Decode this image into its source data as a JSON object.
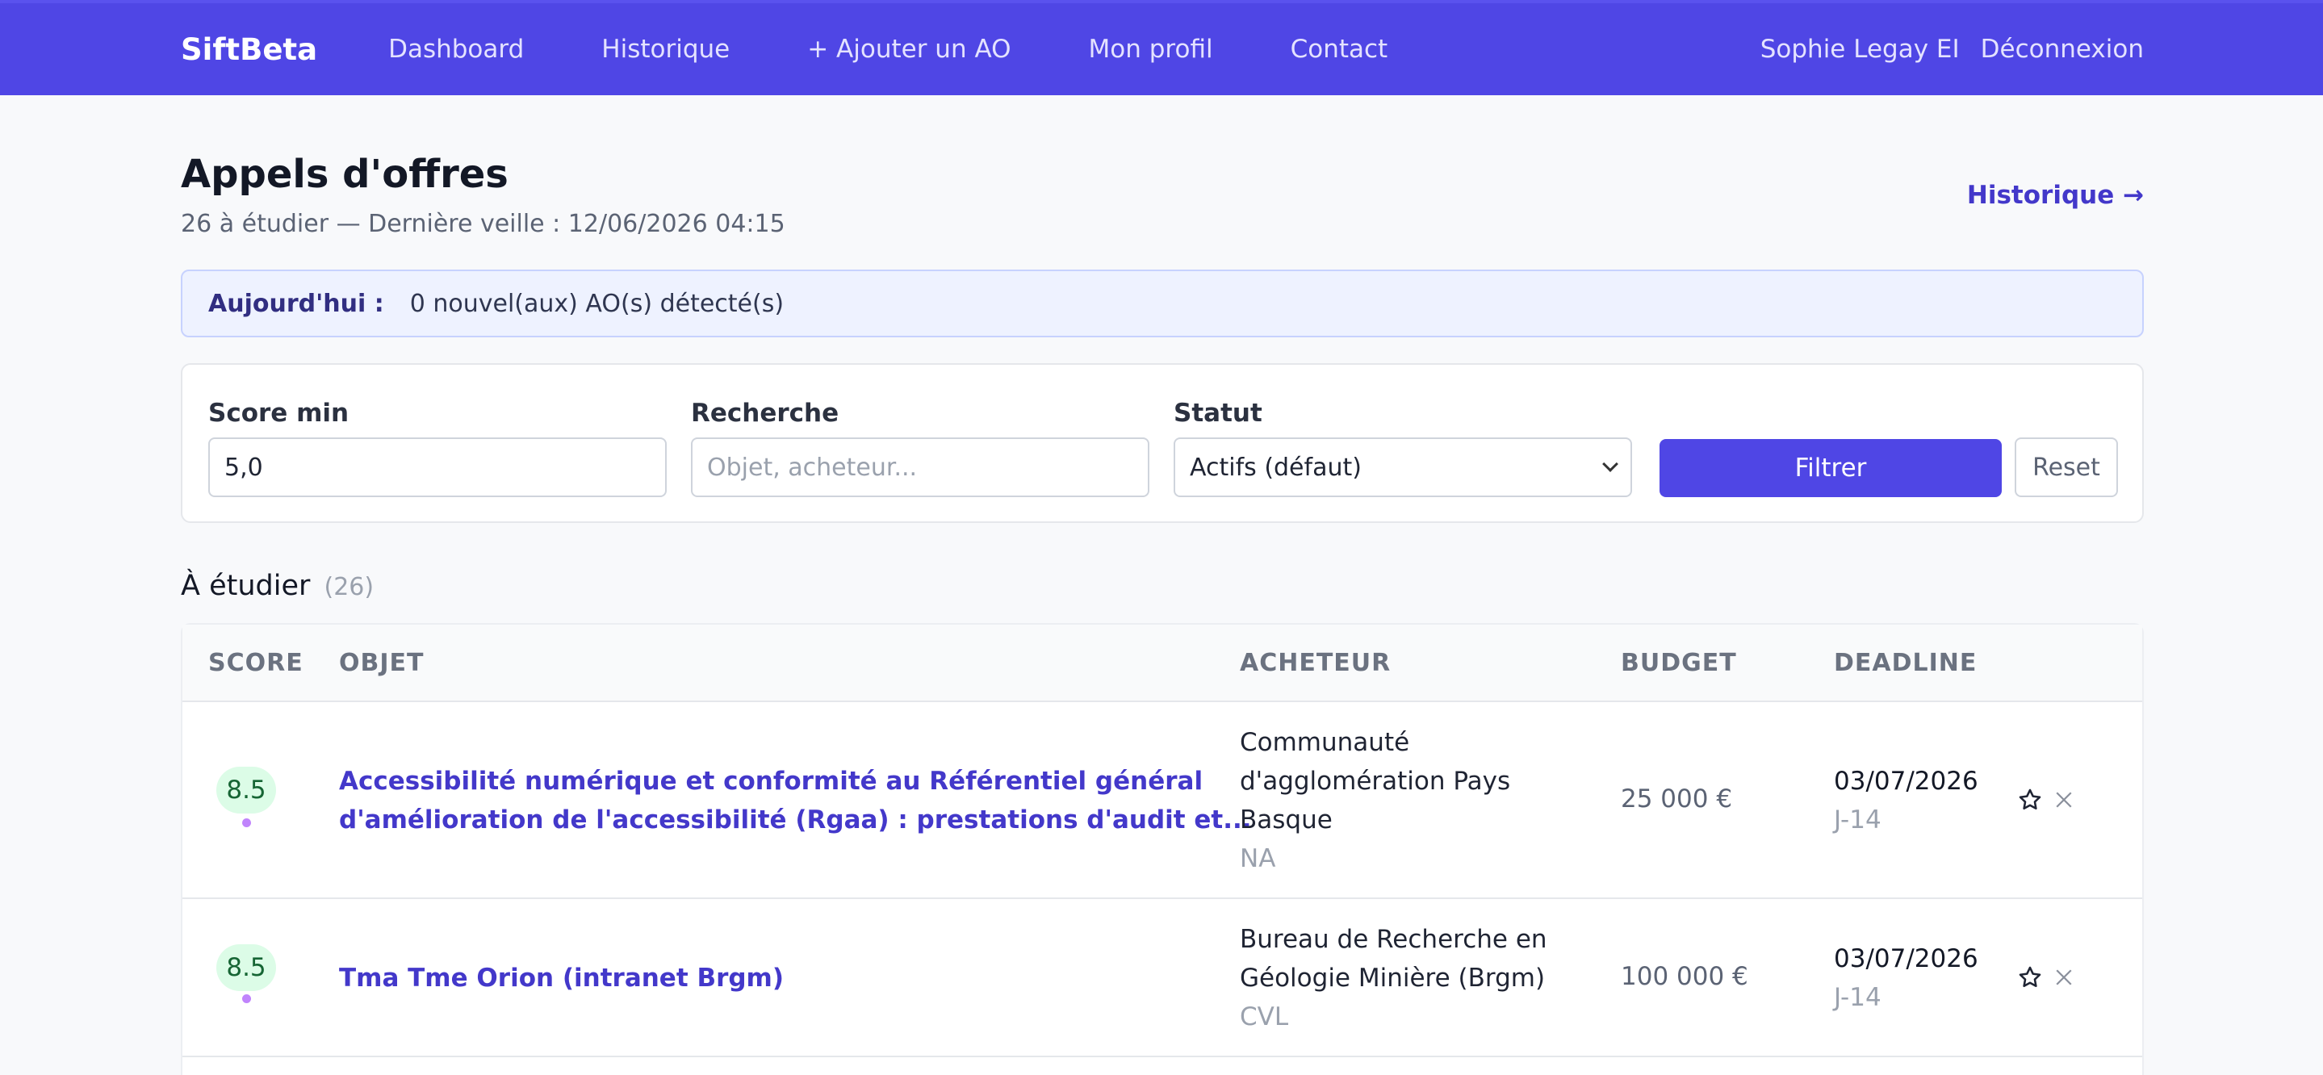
{
  "nav": {
    "brand": "SiftBeta",
    "links": [
      "Dashboard",
      "Historique",
      "+ Ajouter un AO",
      "Mon profil",
      "Contact"
    ],
    "user": "Sophie Legay EI",
    "logout": "Déconnexion"
  },
  "header": {
    "title": "Appels d'offres",
    "subtitle": "26 à étudier — Dernière veille : 12/06/2026 04:15",
    "history_link": "Historique →"
  },
  "banner": {
    "label": "Aujourd'hui :",
    "text": "0 nouvel(aux) AO(s) détecté(s)"
  },
  "filters": {
    "score_label": "Score min",
    "score_value": "5,0",
    "search_label": "Recherche",
    "search_placeholder": "Objet, acheteur...",
    "status_label": "Statut",
    "status_value": "Actifs (défaut)",
    "filter_button": "Filtrer",
    "reset_button": "Reset"
  },
  "section": {
    "title": "À étudier",
    "count": "(26)"
  },
  "table": {
    "headers": [
      "SCORE",
      "OBJET",
      "ACHETEUR",
      "BUDGET",
      "DEADLINE"
    ],
    "rows": [
      {
        "score": "8.5",
        "objet_line1": "Accessibilité numérique et conformité au Référentiel général",
        "objet_line2": "d'amélioration de l'accessibilité (Rgaa) : prestations d'audit et...",
        "buyer_line1": "Communauté",
        "buyer_line2": "d'agglomération Pays",
        "buyer_line3": "Basque",
        "buyer_sub": "NA",
        "budget": "25 000 €",
        "deadline": "03/07/2026",
        "deadline_sub": "J-14"
      },
      {
        "score": "8.5",
        "objet_line1": "Tma Tme Orion (intranet Brgm)",
        "buyer_line1": "Bureau de Recherche en",
        "buyer_line2": "Géologie Minière (Brgm)",
        "buyer_sub": "CVL",
        "budget": "100 000 €",
        "deadline": "03/07/2026",
        "deadline_sub": "J-14"
      }
    ]
  },
  "icons": {
    "favorite": "star-icon",
    "dismiss": "close-icon",
    "dropdown": "chevron-down-icon"
  },
  "colors": {
    "accent": "#4f46e5",
    "score_bg": "#dcfce7",
    "score_text": "#166534",
    "link": "#4338ca"
  }
}
